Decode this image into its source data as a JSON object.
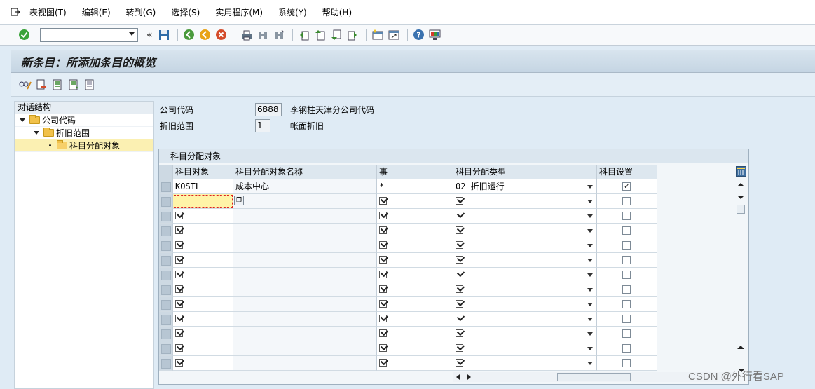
{
  "menu": {
    "items": [
      "表视图(T)",
      "编辑(E)",
      "转到(G)",
      "选择(S)",
      "实用程序(M)",
      "系统(Y)",
      "帮助(H)"
    ]
  },
  "toolbar": {
    "command_field_value": ""
  },
  "page": {
    "title": "新条目：所添加条目的概览"
  },
  "nav": {
    "header": "对话结构",
    "items": [
      {
        "label": "公司代码",
        "level": 0
      },
      {
        "label": "折旧范围",
        "level": 1
      },
      {
        "label": "科目分配对象",
        "level": 2,
        "selected": true
      }
    ]
  },
  "header_fields": {
    "company_code_label": "公司代码",
    "company_code_value": "6888",
    "company_code_desc": "李钢柱天津分公司代码",
    "dep_area_label": "折旧范围",
    "dep_area_value": "1",
    "dep_area_desc": "帐面折旧"
  },
  "table": {
    "title": "科目分配对象",
    "columns": [
      "科目对象",
      "科目分配对象名称",
      "事",
      "科目分配类型",
      "科目设置"
    ],
    "rows": [
      {
        "obj": "KOSTL",
        "name": "成本中心",
        "event": "*",
        "type": "02 折旧运行",
        "setting": true
      },
      {
        "obj": "",
        "name": "",
        "event": "",
        "type": "",
        "setting": false
      },
      {
        "obj": "",
        "name": "",
        "event": "",
        "type": "",
        "setting": false
      },
      {
        "obj": "",
        "name": "",
        "event": "",
        "type": "",
        "setting": false
      },
      {
        "obj": "",
        "name": "",
        "event": "",
        "type": "",
        "setting": false
      },
      {
        "obj": "",
        "name": "",
        "event": "",
        "type": "",
        "setting": false
      },
      {
        "obj": "",
        "name": "",
        "event": "",
        "type": "",
        "setting": false
      },
      {
        "obj": "",
        "name": "",
        "event": "",
        "type": "",
        "setting": false
      },
      {
        "obj": "",
        "name": "",
        "event": "",
        "type": "",
        "setting": false
      },
      {
        "obj": "",
        "name": "",
        "event": "",
        "type": "",
        "setting": false
      },
      {
        "obj": "",
        "name": "",
        "event": "",
        "type": "",
        "setting": false
      },
      {
        "obj": "",
        "name": "",
        "event": "",
        "type": "",
        "setting": false
      },
      {
        "obj": "",
        "name": "",
        "event": "",
        "type": "",
        "setting": false
      }
    ]
  },
  "watermark": "CSDN @外行看SAP"
}
